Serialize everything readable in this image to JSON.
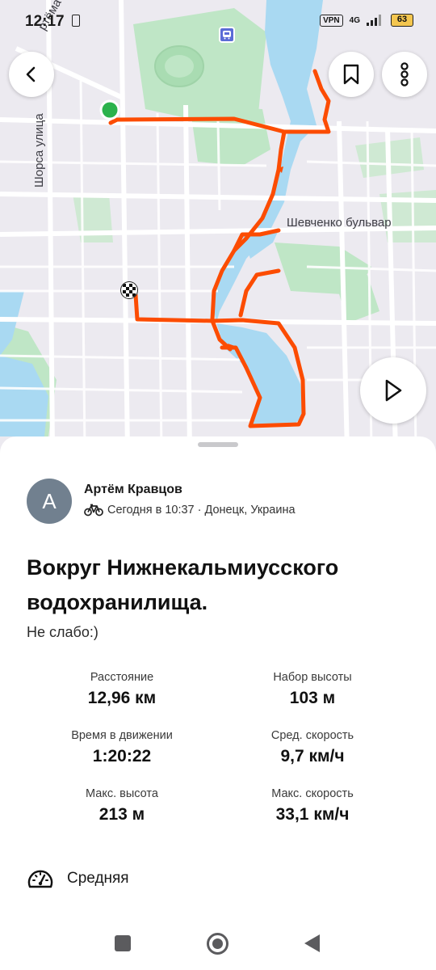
{
  "status_bar": {
    "time": "12:17",
    "vpn": "VPN",
    "network": "4G",
    "battery": "63"
  },
  "map": {
    "labels": {
      "street_1": "ртёма улица",
      "street_2": "Шорса улица",
      "boulevard": "Шевченко бульвар"
    },
    "route_color": "#fc4c02",
    "water_color": "#a9d9f2",
    "park_color": "#bfe6c6",
    "start_marker_color": "#2bb24c",
    "icons": {
      "back": "chevron-left-icon",
      "bookmark": "bookmark-icon",
      "more": "more-vertical-icon",
      "play": "play-icon",
      "metro": "metro-station-icon",
      "finish": "checkered-flag-icon"
    }
  },
  "athlete": {
    "avatar_letter": "A",
    "name": "Артём Кравцов",
    "meta": "Сегодня в 10:37 · Донецк, Украина",
    "sport_icon": "bicycle-icon"
  },
  "activity": {
    "title": "Вокруг Нижнекальмиусского водохранилища.",
    "description": "Не слабо:)"
  },
  "stats": {
    "distance": {
      "label": "Расстояние",
      "value": "12,96 км"
    },
    "elevation_gain": {
      "label": "Набор высоты",
      "value": "103 м"
    },
    "moving_time": {
      "label": "Время в движении",
      "value": "1:20:22"
    },
    "avg_speed": {
      "label": "Сред. скорость",
      "value": "9,7 км/ч"
    },
    "max_elevation": {
      "label": "Макс. высота",
      "value": "213 м"
    },
    "max_speed": {
      "label": "Макс. скорость",
      "value": "33,1 км/ч"
    }
  },
  "effort": {
    "label": "Средняя",
    "icon": "speedometer-icon"
  }
}
